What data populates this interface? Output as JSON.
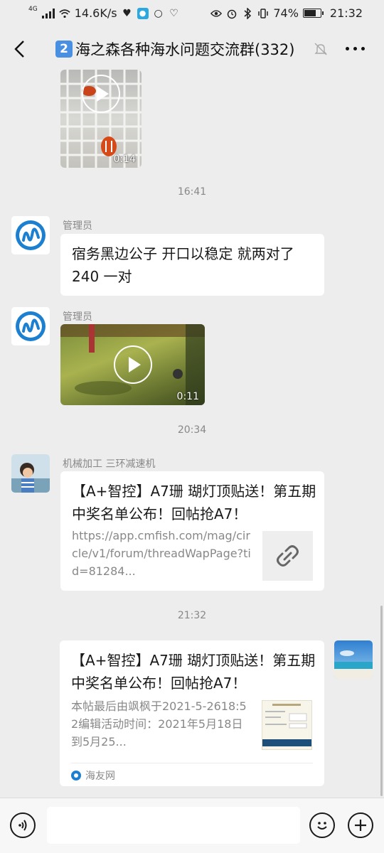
{
  "status_bar": {
    "network": "4G",
    "speed": "14.6K/s",
    "battery": "74%",
    "time": "21:32"
  },
  "header": {
    "title": "海之森各种海水问题交流群(332)",
    "badge": "2"
  },
  "messages": {
    "video1": {
      "duration": "0:14"
    },
    "time1": "16:41",
    "msg1": {
      "sender": "管理员",
      "text": "宿务黑边公子 开口以稳定 就两对了 240 一对"
    },
    "msg2": {
      "sender": "管理员",
      "duration": "0:11"
    },
    "time2": "20:34",
    "msg3": {
      "sender": "机械加工  三环减速机",
      "title": "【A+智控】A7珊 瑚灯顶贴送！第五期中奖名单公布！回帖抢A7！",
      "desc": "https://app.cmfish.com/mag/circle/v1/forum/threadWapPage?tid=81284..."
    },
    "time3": "21:32",
    "msg4": {
      "title": "【A+智控】A7珊 瑚灯顶贴送！第五期中奖名单公布！回帖抢A7！",
      "desc": "本帖最后由飒枫于2021-5-2618:52编辑活动时间：2021年5月18日到5月25...",
      "source": "海友网"
    }
  },
  "colors": {
    "background": "#ededed",
    "bubble": "#ffffff",
    "muted_text": "#888888",
    "badge_blue": "#4a90e2"
  }
}
